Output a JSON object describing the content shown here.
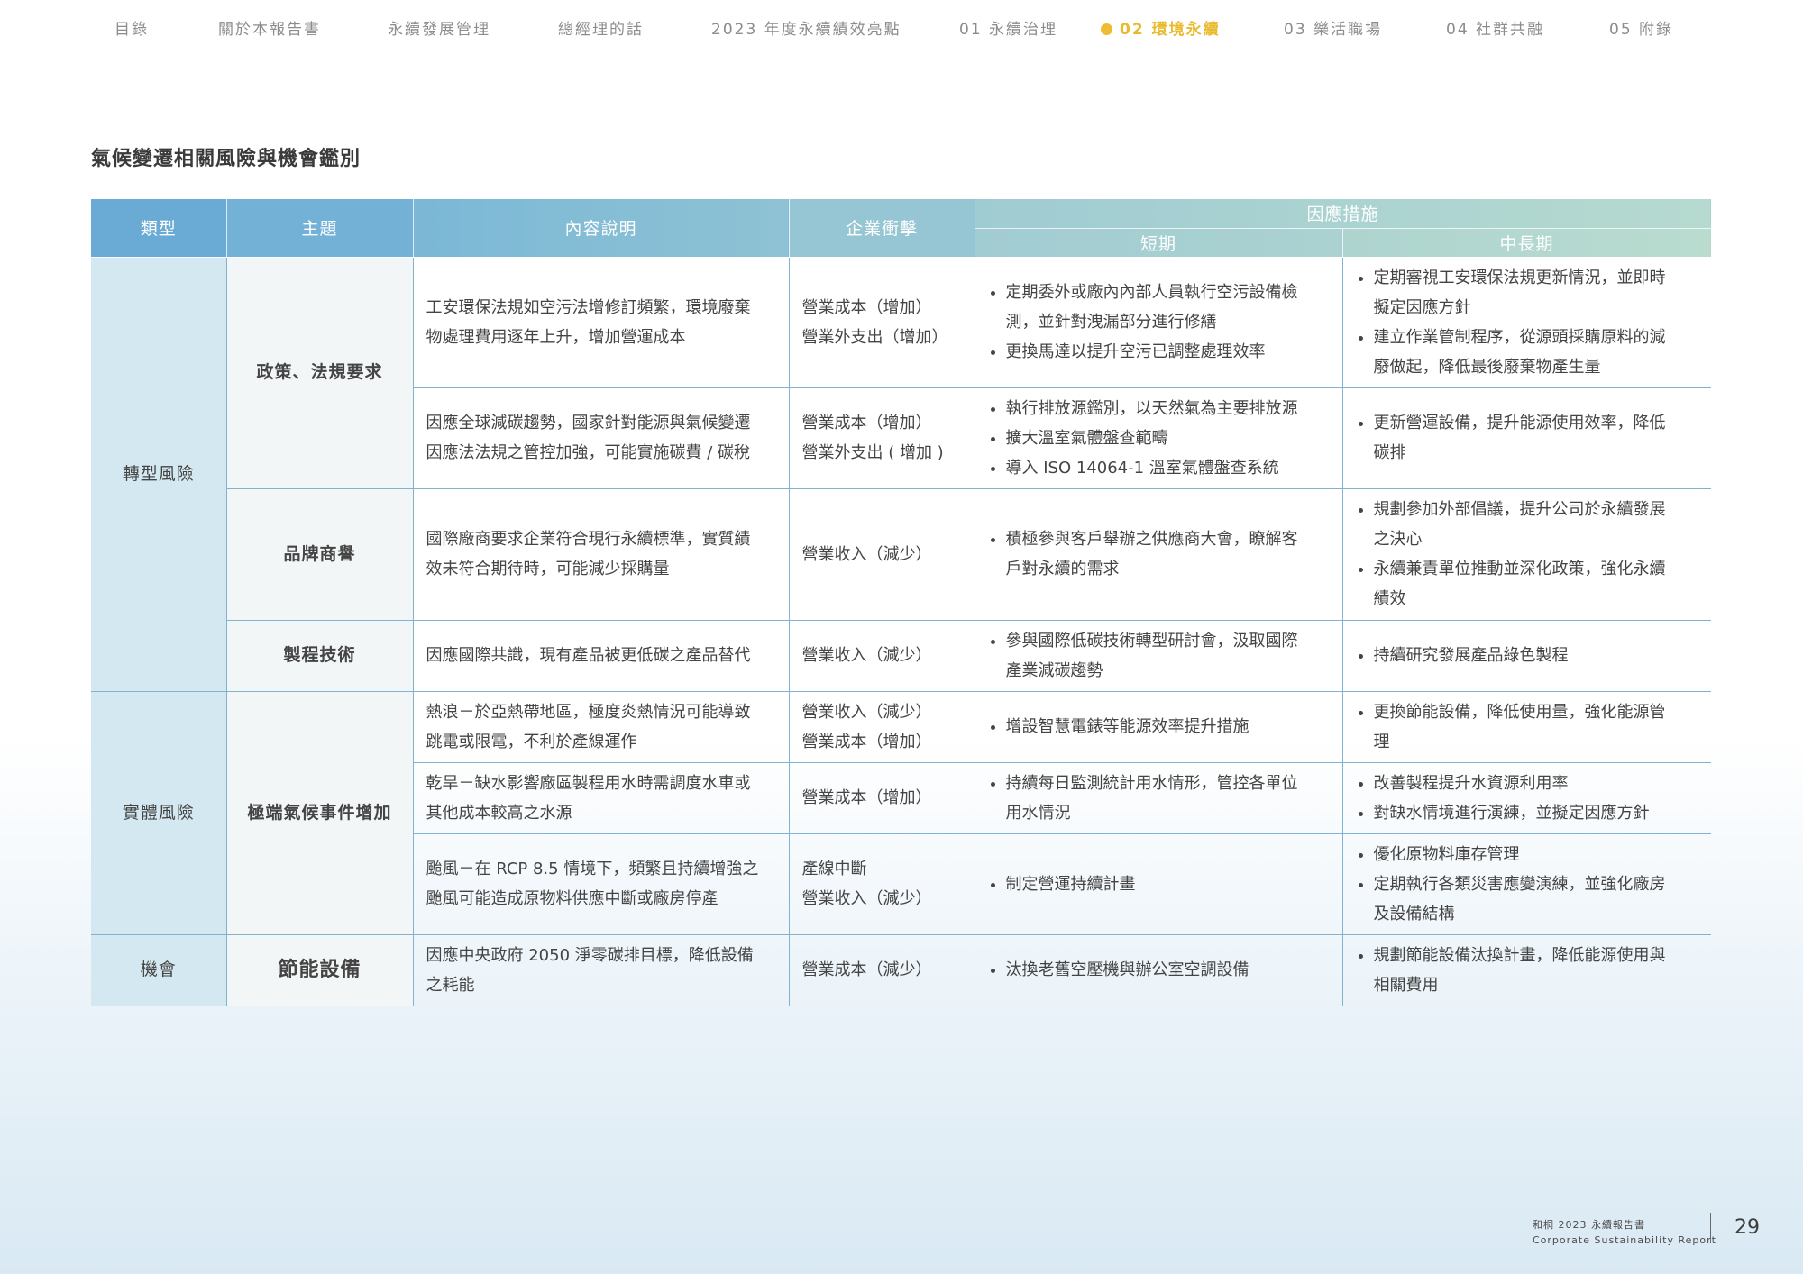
{
  "nav": {
    "items": [
      {
        "label": "目錄",
        "active": false
      },
      {
        "label": "關於本報告書",
        "active": false
      },
      {
        "label": "永續發展管理",
        "active": false
      },
      {
        "label": "總經理的話",
        "active": false
      },
      {
        "label": "2023 年度永續績效亮點",
        "active": false
      },
      {
        "label": "01 永續治理",
        "active": false
      },
      {
        "label": "02 環境永續",
        "active": true
      },
      {
        "label": "03 樂活職場",
        "active": false
      },
      {
        "label": "04 社群共融",
        "active": false
      },
      {
        "label": "05 附錄",
        "active": false
      }
    ],
    "active_color": "#e8ba2c"
  },
  "title": "氣候變遷相關風險與機會鑑別",
  "table": {
    "headers": {
      "type": "類型",
      "topic": "主題",
      "desc": "內容說明",
      "impact": "企業衝擊",
      "measures": "因應措施",
      "short": "短期",
      "mid_long": "中長期"
    },
    "rows": [
      {
        "category": "轉型風險",
        "topic": "政策、法規要求",
        "desc": [
          "工安環保法規如空污法增修訂頻繁，環境廢棄",
          "物處理費用逐年上升，增加營運成本"
        ],
        "impact": [
          "營業成本（增加）",
          "營業外支出（增加）"
        ],
        "short": [
          [
            "定期委外或廠內內部人員執行空污設備檢",
            "測，並針對洩漏部分進行修繕"
          ],
          [
            "更換馬達以提升空污已調整處理效率"
          ]
        ],
        "mid": [
          [
            "定期審視工安環保法規更新情況，並即時",
            "擬定因應方針"
          ],
          [
            "建立作業管制程序，從源頭採購原料的減",
            "廢做起，降低最後廢棄物產生量"
          ]
        ]
      },
      {
        "desc": [
          "因應全球減碳趨勢，國家針對能源與氣候變遷",
          "因應法法規之管控加強，可能實施碳費 / 碳稅"
        ],
        "impact": [
          "營業成本（增加）",
          "營業外支出 ( 增加 )"
        ],
        "short": [
          [
            "執行排放源鑑別，以天然氣為主要排放源"
          ],
          [
            "擴大溫室氣體盤查範疇"
          ],
          [
            "導入 ISO 14064-1 溫室氣體盤查系統"
          ]
        ],
        "mid": [
          [
            "更新營運設備，提升能源使用效率，降低",
            "碳排"
          ]
        ]
      },
      {
        "topic": "品牌商譽",
        "desc": [
          "國際廠商要求企業符合現行永續標準，實質績",
          "效未符合期待時，可能減少採購量"
        ],
        "impact": [
          "營業收入（減少）"
        ],
        "short": [
          [
            "積極參與客戶舉辦之供應商大會，瞭解客",
            "戶對永續的需求"
          ]
        ],
        "mid": [
          [
            "規劃參加外部倡議，提升公司於永續發展",
            "之決心"
          ],
          [
            "永續兼責單位推動並深化政策，強化永續",
            "績效"
          ]
        ]
      },
      {
        "topic": "製程技術",
        "desc": [
          "因應國際共識，現有產品被更低碳之產品替代"
        ],
        "impact": [
          "營業收入（減少）"
        ],
        "short": [
          [
            "參與國際低碳技術轉型研討會，汲取國際",
            "產業減碳趨勢"
          ]
        ],
        "mid": [
          [
            "持續研究發展產品綠色製程"
          ]
        ]
      },
      {
        "category": "實體風險",
        "topic": "極端氣候事件增加",
        "desc": [
          "熱浪－於亞熱帶地區，極度炎熱情況可能導致",
          "跳電或限電，不利於產線運作"
        ],
        "impact": [
          "營業收入（減少）",
          "營業成本（增加）"
        ],
        "short": [
          [
            "增設智慧電錶等能源效率提升措施"
          ]
        ],
        "mid": [
          [
            "更換節能設備，降低使用量，強化能源管",
            "理"
          ]
        ]
      },
      {
        "desc": [
          "乾旱－缺水影響廠區製程用水時需調度水車或",
          "其他成本較高之水源"
        ],
        "impact": [
          "營業成本（增加）"
        ],
        "short": [
          [
            "持續每日監測統計用水情形，管控各單位",
            "用水情況"
          ]
        ],
        "mid": [
          [
            "改善製程提升水資源利用率"
          ],
          [
            "對缺水情境進行演練，並擬定因應方針"
          ]
        ]
      },
      {
        "desc": [
          "颱風－在 RCP 8.5 情境下，頻繁且持續增強之",
          "颱風可能造成原物料供應中斷或廠房停產"
        ],
        "impact": [
          "產線中斷",
          "營業收入（減少）"
        ],
        "short": [
          [
            "制定營運持續計畫"
          ]
        ],
        "mid": [
          [
            "優化原物料庫存管理"
          ],
          [
            "定期執行各類災害應變演練，並強化廠房",
            "及設備結構"
          ]
        ]
      },
      {
        "category": "機會",
        "topic": "節能設備",
        "desc": [
          "因應中央政府 2050 淨零碳排目標，降低設備",
          "之耗能"
        ],
        "impact": [
          "營業成本（減少）"
        ],
        "short": [
          [
            "汰換老舊空壓機與辦公室空調設備"
          ]
        ],
        "mid": [
          [
            "規劃節能設備汰換計畫，降低能源使用與",
            "相關費用"
          ]
        ]
      }
    ]
  },
  "footer": {
    "report_zh": "和桐 2023 永續報告書",
    "report_en": "Corporate Sustainability Report",
    "page_number": "29"
  }
}
